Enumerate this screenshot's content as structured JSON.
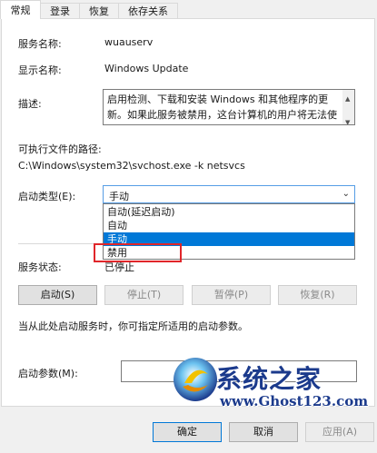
{
  "tabs": [
    "常规",
    "登录",
    "恢复",
    "依存关系"
  ],
  "general": {
    "service_name_label": "服务名称:",
    "service_name": "wuauserv",
    "display_name_label": "显示名称:",
    "display_name": "Windows Update",
    "description_label": "描述:",
    "description": "启用检测、下载和安装 Windows 和其他程序的更新。如果此服务被禁用，这台计算机的用户将无法使用",
    "exe_path_label": "可执行文件的路径:",
    "exe_path": "C:\\Windows\\system32\\svchost.exe -k netsvcs",
    "startup_type_label": "启动类型(E):",
    "startup_type_value": "手动",
    "startup_options": [
      "自动(延迟启动)",
      "自动",
      "手动",
      "禁用"
    ],
    "service_status_label": "服务状态:",
    "service_status_value": "已停止",
    "buttons": {
      "start": "启动(S)",
      "stop": "停止(T)",
      "pause": "暂停(P)",
      "resume": "恢复(R)"
    },
    "hint": "当从此处启动服务时，你可指定所适用的启动参数。",
    "start_params_label": "启动参数(M):"
  },
  "footer": {
    "ok": "确定",
    "cancel": "取消",
    "apply": "应用(A)"
  },
  "watermark": {
    "title": "系统之家",
    "url": "www.Ghost123.com"
  }
}
